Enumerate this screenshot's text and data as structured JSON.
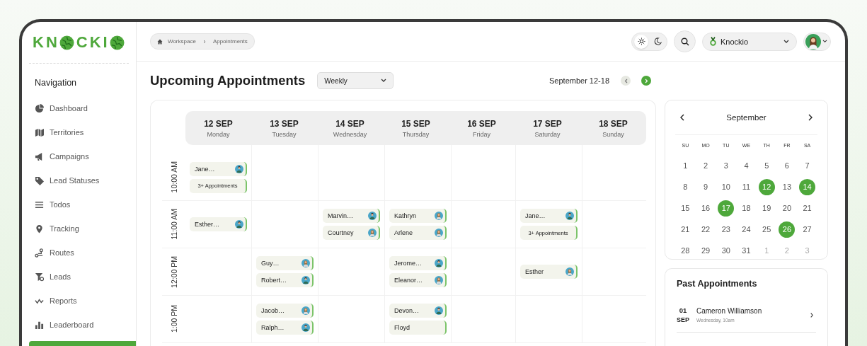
{
  "logo_parts": [
    "KN",
    "CKI"
  ],
  "sidebar": {
    "heading": "Navigation",
    "items": [
      {
        "label": "Dashboard",
        "selected": false
      },
      {
        "label": "Territories",
        "selected": false
      },
      {
        "label": "Campaigns",
        "selected": false
      },
      {
        "label": "Lead Statuses",
        "selected": false
      },
      {
        "label": "Todos",
        "selected": false
      },
      {
        "label": "Tracking",
        "selected": false
      },
      {
        "label": "Routes",
        "selected": false
      },
      {
        "label": "Leads",
        "selected": false
      },
      {
        "label": "Reports",
        "selected": false
      },
      {
        "label": "Leaderboard",
        "selected": false
      },
      {
        "selected": true
      }
    ]
  },
  "topbar": {
    "breadcrumb": [
      "Workspace",
      "Appointments"
    ],
    "theme_options": [
      {
        "selected": true
      },
      {
        "selected": false
      }
    ],
    "org": "Knockio"
  },
  "page_title": "Upcoming Appointments",
  "view_select": "Weekly",
  "range": "September 12-18",
  "week": {
    "days": [
      {
        "date": "12 SEP",
        "weekday": "Monday"
      },
      {
        "date": "13 SEP",
        "weekday": "Tuesday"
      },
      {
        "date": "14 SEP",
        "weekday": "Wednesday"
      },
      {
        "date": "15 SEP",
        "weekday": "Thursday"
      },
      {
        "date": "16 SEP",
        "weekday": "Friday"
      },
      {
        "date": "17 SEP",
        "weekday": "Saturday"
      },
      {
        "date": "18 SEP",
        "weekday": "Sunday"
      }
    ],
    "rows": [
      {
        "time": "10:00 AM",
        "cells": [
          {
            "appointments": [
              {
                "kind": "man",
                "name": "Jane…"
              },
              {
                "kind": "more",
                "name": "3+ Appointments"
              }
            ]
          },
          {},
          {},
          {},
          {},
          {},
          {}
        ]
      },
      {
        "time": "11:00 AM",
        "cells": [
          {
            "appointments": [
              {
                "kind": "man",
                "name": "Esther…"
              }
            ]
          },
          {},
          {
            "appointments": [
              {
                "kind": "man",
                "name": "Marvin…"
              },
              {
                "kind": "woman",
                "name": "Courtney"
              }
            ]
          },
          {
            "appointments": [
              {
                "kind": "woman",
                "name": "Kathryn"
              },
              {
                "kind": "woman",
                "name": "Arlene"
              }
            ]
          },
          {},
          {
            "appointments": [
              {
                "kind": "man",
                "name": "Jane…"
              },
              {
                "kind": "more",
                "name": "3+ Appointments"
              }
            ]
          },
          {}
        ]
      },
      {
        "time": "12:00 PM",
        "cells": [
          {},
          {
            "appointments": [
              {
                "kind": "woman",
                "name": "Guy…"
              },
              {
                "kind": "man",
                "name": "Robert…"
              }
            ]
          },
          {},
          {
            "appointments": [
              {
                "kind": "man",
                "name": "Jerome…"
              },
              {
                "kind": "woman",
                "name": "Eleanor…"
              }
            ]
          },
          {},
          {
            "appointments": [
              {
                "kind": "woman",
                "name": "Esther"
              }
            ]
          },
          {}
        ]
      },
      {
        "time": "1:00 PM",
        "cells": [
          {},
          {
            "appointments": [
              {
                "kind": "woman",
                "name": "Jacob…"
              },
              {
                "kind": "man",
                "name": "Ralph…"
              }
            ]
          },
          {},
          {
            "appointments": [
              {
                "kind": "man",
                "name": "Devon…"
              },
              {
                "kind": "plain",
                "name": "Floyd"
              }
            ]
          },
          {},
          {},
          {}
        ]
      }
    ]
  },
  "mini_calendar": {
    "month": "September",
    "weekdays": [
      "SU",
      "MO",
      "TU",
      "WE",
      "TH",
      "FR",
      "SA"
    ],
    "weeks": [
      [
        {
          "day": "1",
          "muted": false,
          "selected": false
        },
        {
          "day": "2",
          "muted": false,
          "selected": false
        },
        {
          "day": "3",
          "muted": false,
          "selected": false
        },
        {
          "day": "4",
          "muted": false,
          "selected": false
        },
        {
          "day": "5",
          "muted": false,
          "selected": false
        },
        {
          "day": "6",
          "muted": false,
          "selected": false
        },
        {
          "day": "7",
          "muted": false,
          "selected": false
        }
      ],
      [
        {
          "day": "8",
          "muted": false,
          "selected": false
        },
        {
          "day": "9",
          "muted": false,
          "selected": false
        },
        {
          "day": "10",
          "muted": false,
          "selected": false
        },
        {
          "day": "11",
          "muted": false,
          "selected": false
        },
        {
          "day": "12",
          "muted": false,
          "selected": true
        },
        {
          "day": "13",
          "muted": false,
          "selected": false
        },
        {
          "day": "14",
          "muted": false,
          "selected": true
        }
      ],
      [
        {
          "day": "15",
          "muted": false,
          "selected": false
        },
        {
          "day": "16",
          "muted": false,
          "selected": false
        },
        {
          "day": "17",
          "muted": false,
          "selected": true
        },
        {
          "day": "18",
          "muted": false,
          "selected": false
        },
        {
          "day": "19",
          "muted": false,
          "selected": false
        },
        {
          "day": "20",
          "muted": false,
          "selected": false
        },
        {
          "day": "21",
          "muted": false,
          "selected": false
        }
      ],
      [
        {
          "day": "21",
          "muted": false,
          "selected": false
        },
        {
          "day": "22",
          "muted": false,
          "selected": false
        },
        {
          "day": "23",
          "muted": false,
          "selected": false
        },
        {
          "day": "24",
          "muted": false,
          "selected": false
        },
        {
          "day": "25",
          "muted": false,
          "selected": false
        },
        {
          "day": "26",
          "muted": false,
          "selected": true
        },
        {
          "day": "27",
          "muted": false,
          "selected": false
        }
      ],
      [
        {
          "day": "28",
          "muted": false,
          "selected": false
        },
        {
          "day": "29",
          "muted": false,
          "selected": false
        },
        {
          "day": "30",
          "muted": false,
          "selected": false
        },
        {
          "day": "31",
          "muted": false,
          "selected": false
        },
        {
          "day": "1",
          "muted": true,
          "selected": false
        },
        {
          "day": "2",
          "muted": true,
          "selected": false
        },
        {
          "day": "3",
          "muted": true,
          "selected": false
        }
      ]
    ]
  },
  "past": {
    "title": "Past Appointments",
    "items": [
      {
        "day": "01",
        "month": "SEP",
        "name": "Cameron Williamson",
        "when": "Wednesday, 10am"
      }
    ]
  }
}
